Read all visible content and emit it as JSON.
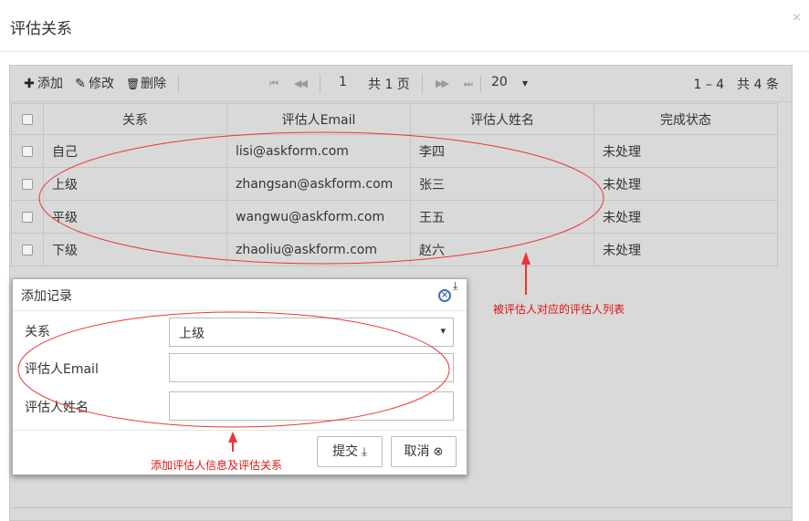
{
  "dialog": {
    "title": "评估关系",
    "close_glyph": "×"
  },
  "toolbar": {
    "add_label": "添加",
    "add_icon": "plus-icon",
    "add_glyph": "✚",
    "edit_label": "修改",
    "edit_icon": "edit-icon",
    "edit_glyph": "✎",
    "delete_label": "删除",
    "delete_icon": "trash-icon",
    "delete_glyph": "🗑"
  },
  "pager": {
    "first_glyph": "⏮",
    "prev_glyph": "◀◀",
    "next_glyph": "▶▶",
    "last_glyph": "⏭",
    "page": "1",
    "total_pages": "共 1 页",
    "page_size": "20",
    "page_size_arrow": "▾",
    "summary": "1 – 4　共 4 条"
  },
  "table": {
    "columns": [
      "关系",
      "评估人Email",
      "评估人姓名",
      "完成状态"
    ],
    "rows": [
      [
        "自己",
        "lisi@askform.com",
        "李四",
        "未处理"
      ],
      [
        "上级",
        "zhangsan@askform.com",
        "张三",
        "未处理"
      ],
      [
        "平级",
        "wangwu@askform.com",
        "王五",
        "未处理"
      ],
      [
        "下级",
        "zhaoliu@askform.com",
        "赵六",
        "未处理"
      ]
    ]
  },
  "modal": {
    "title": "添加记录",
    "close_glyph": "×",
    "pin_glyph": "⤓",
    "relation_label": "关系",
    "relation_value": "上级",
    "relation_arrow": "▾",
    "email_label": "评估人Email",
    "email_value": "",
    "name_label": "评估人姓名",
    "name_value": "",
    "submit_label": "提交",
    "submit_glyph": "⤓",
    "cancel_label": "取消",
    "cancel_glyph": "⊗"
  },
  "annotations": {
    "table_note": "被评估人对应的评估人列表",
    "form_note": "添加评估人信息及评估关系",
    "color": "#dd1111"
  }
}
